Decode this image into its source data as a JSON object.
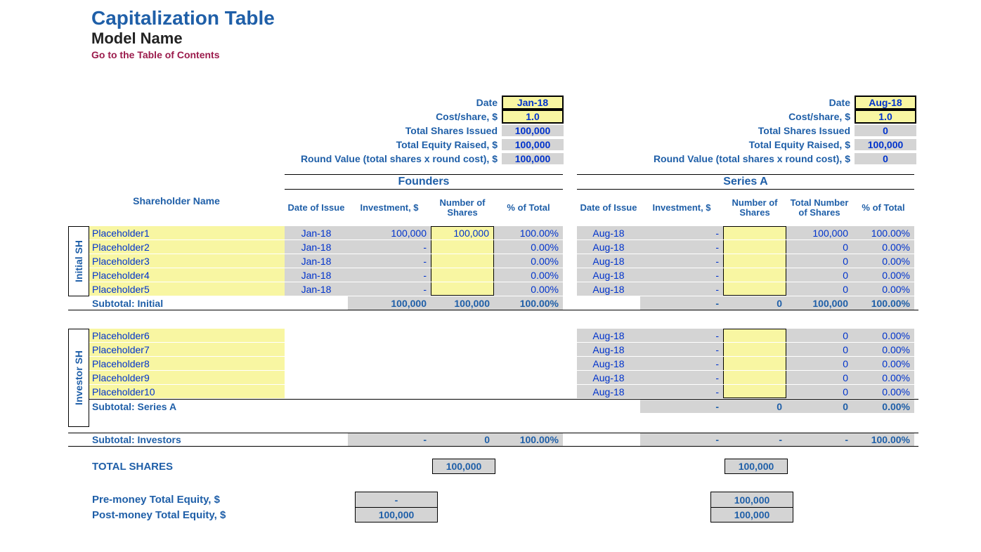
{
  "header": {
    "title": "Capitalization Table",
    "subtitle": "Model Name",
    "toc_link": "Go to the Table of Contents"
  },
  "rounds": {
    "labels": {
      "date": "Date",
      "cost": "Cost/share, $",
      "shares_issued": "Total Shares Issued",
      "equity_raised": "Total Equity Raised, $",
      "round_value": "Round Value (total shares x round cost), $"
    },
    "founders": {
      "date": "Jan-18",
      "cost": "1.0",
      "shares_issued": "100,000",
      "equity_raised": "100,000",
      "round_value": "100,000",
      "heading": "Founders"
    },
    "seriesA": {
      "date": "Aug-18",
      "cost": "1.0",
      "shares_issued": "0",
      "equity_raised": "100,000",
      "round_value": "0",
      "heading": "Series A"
    }
  },
  "columns": {
    "shareholder_name": "Shareholder Name",
    "date_of_issue": "Date of Issue",
    "investment": "Investment, $",
    "num_shares": "Number of Shares",
    "pct_total": "% of Total",
    "total_num_shares": "Total Number of Shares"
  },
  "vlabels": {
    "initial": "Initial SH",
    "investor": "Investor SH"
  },
  "initial_rows": [
    {
      "name": "Placeholder1",
      "f_date": "Jan-18",
      "f_inv": "100,000",
      "f_num": "100,000",
      "f_pct": "100.00%",
      "a_date": "Aug-18",
      "a_inv": "-",
      "a_num": "",
      "a_tot": "100,000",
      "a_pct": "100.00%"
    },
    {
      "name": "Placeholder2",
      "f_date": "Jan-18",
      "f_inv": "-",
      "f_num": "",
      "f_pct": "0.00%",
      "a_date": "Aug-18",
      "a_inv": "-",
      "a_num": "",
      "a_tot": "0",
      "a_pct": "0.00%"
    },
    {
      "name": "Placeholder3",
      "f_date": "Jan-18",
      "f_inv": "-",
      "f_num": "",
      "f_pct": "0.00%",
      "a_date": "Aug-18",
      "a_inv": "-",
      "a_num": "",
      "a_tot": "0",
      "a_pct": "0.00%"
    },
    {
      "name": "Placeholder4",
      "f_date": "Jan-18",
      "f_inv": "-",
      "f_num": "",
      "f_pct": "0.00%",
      "a_date": "Aug-18",
      "a_inv": "-",
      "a_num": "",
      "a_tot": "0",
      "a_pct": "0.00%"
    },
    {
      "name": "Placeholder5",
      "f_date": "Jan-18",
      "f_inv": "-",
      "f_num": "",
      "f_pct": "0.00%",
      "a_date": "Aug-18",
      "a_inv": "-",
      "a_num": "",
      "a_tot": "0",
      "a_pct": "0.00%"
    }
  ],
  "subtotal_initial": {
    "label": "Subtotal: Initial",
    "f_inv": "100,000",
    "f_num": "100,000",
    "f_pct": "100.00%",
    "a_inv": "-",
    "a_num": "0",
    "a_tot": "100,000",
    "a_pct": "100.00%"
  },
  "investor_rows": [
    {
      "name": "Placeholder6",
      "a_date": "Aug-18",
      "a_inv": "-",
      "a_num": "",
      "a_tot": "0",
      "a_pct": "0.00%"
    },
    {
      "name": "Placeholder7",
      "a_date": "Aug-18",
      "a_inv": "-",
      "a_num": "",
      "a_tot": "0",
      "a_pct": "0.00%"
    },
    {
      "name": "Placeholder8",
      "a_date": "Aug-18",
      "a_inv": "-",
      "a_num": "",
      "a_tot": "0",
      "a_pct": "0.00%"
    },
    {
      "name": "Placeholder9",
      "a_date": "Aug-18",
      "a_inv": "-",
      "a_num": "",
      "a_tot": "0",
      "a_pct": "0.00%"
    },
    {
      "name": "Placeholder10",
      "a_date": "Aug-18",
      "a_inv": "-",
      "a_num": "",
      "a_tot": "0",
      "a_pct": "0.00%"
    }
  ],
  "subtotal_seriesA": {
    "label": "Subtotal: Series A",
    "a_inv": "-",
    "a_num": "0",
    "a_tot": "0",
    "a_pct": "0.00%"
  },
  "subtotal_investors": {
    "label": "Subtotal: Investors",
    "f_inv": "-",
    "f_num": "0",
    "f_pct": "100.00%",
    "a_inv": "-",
    "a_num": "-",
    "a_tot": "-",
    "a_pct": "100.00%"
  },
  "totals": {
    "label": "TOTAL SHARES",
    "f": "100,000",
    "a": "100,000",
    "pre_label": "Pre-money Total Equity, $",
    "pre_f": "-",
    "pre_a": "100,000",
    "post_label": "Post-money Total Equity, $",
    "post_f": "100,000",
    "post_a": "100,000"
  }
}
